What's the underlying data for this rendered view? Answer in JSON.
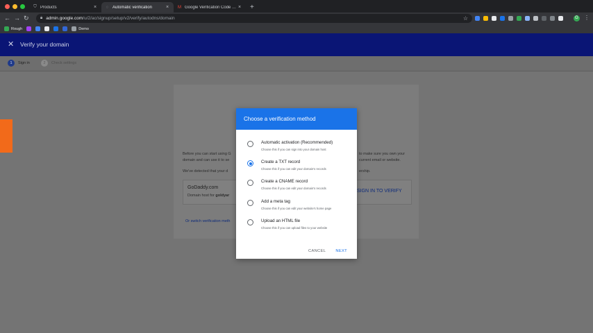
{
  "browser": {
    "tabs": [
      {
        "title": "Products",
        "active": false
      },
      {
        "title": "Automatic verification",
        "active": true
      },
      {
        "title": "Google Verification Code - ad…",
        "active": false
      }
    ],
    "url": {
      "host": "admin.google.com",
      "path": "/u/2/ac/signup/setup/v2/verify/autodns/domain"
    },
    "bookmarks": [
      {
        "label": "Rough"
      },
      {
        "label": "Demo"
      }
    ]
  },
  "app": {
    "title": "Verify your domain",
    "steps": [
      {
        "number": "1",
        "label": "Sign in",
        "active": true
      },
      {
        "number": "2",
        "label": "Check settings",
        "active": false
      }
    ]
  },
  "background": {
    "intro_left": "Before you can start using G",
    "intro_right": "to make sure you own your",
    "intro_left_2": "domain and can use it to se",
    "intro_right_2": "current email or website.",
    "detected_left": "We've detected that your d",
    "detected_right": "ership.",
    "provider_name": "GoDaddy.com",
    "provider_sub_prefix": "Domain host for ",
    "provider_domain": "goldyar",
    "sign_in_label": "SIGN IN TO VERIFY",
    "switch_link": "Or switch verification meth"
  },
  "dialog": {
    "title": "Choose a verification method",
    "options": [
      {
        "label": "Automatic activation (Recommended)",
        "description": "Choose this if you can sign into your domain host",
        "selected": false
      },
      {
        "label": "Create a TXT record",
        "description": "Choose this if you can edit your domain's records",
        "selected": true
      },
      {
        "label": "Create a CNAME record",
        "description": "Choose this if you can edit your domain's records",
        "selected": false
      },
      {
        "label": "Add a meta tag",
        "description": "Choose this if you can edit your website's home page",
        "selected": false
      },
      {
        "label": "Upload an HTML file",
        "description": "Choose this if you can upload files to your website",
        "selected": false
      }
    ],
    "cancel_label": "CANCEL",
    "next_label": "NEXT"
  },
  "colors": {
    "app_bar": "#0a1575",
    "primary": "#1a73e8",
    "accent_tab": "#f26a1a"
  },
  "icons": {
    "close": "close-icon",
    "lock": "lock-icon",
    "star": "star-icon",
    "back": "back-arrow-icon",
    "forward": "forward-arrow-icon",
    "reload": "reload-icon"
  }
}
